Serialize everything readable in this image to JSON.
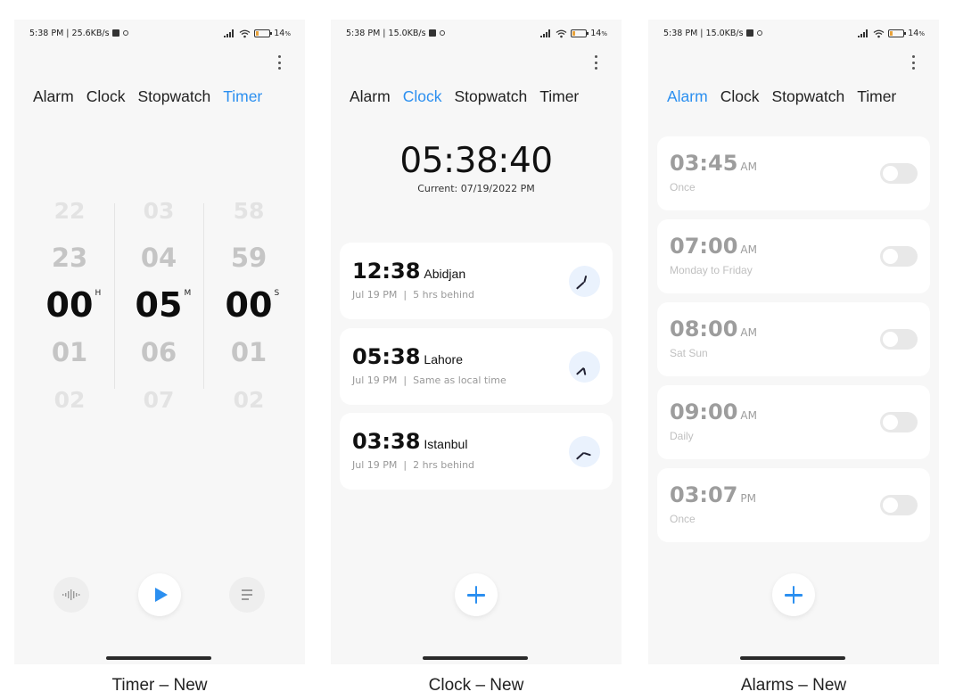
{
  "screens": [
    {
      "status": {
        "time_speed": "5:38 PM | 25.6KB/s",
        "battery_value": "14",
        "battery_unit": "%"
      },
      "tabs": [
        "Alarm",
        "Clock",
        "Stopwatch",
        "Timer"
      ],
      "active_tab": "Timer",
      "timer": {
        "hours": [
          "22",
          "23",
          "00",
          "01",
          "02"
        ],
        "minutes": [
          "03",
          "04",
          "05",
          "06",
          "07"
        ],
        "seconds": [
          "58",
          "59",
          "00",
          "01",
          "02"
        ],
        "units": {
          "hours": "H",
          "minutes": "M",
          "seconds": "S"
        }
      },
      "caption": "Timer – New"
    },
    {
      "status": {
        "time_speed": "5:38 PM | 15.0KB/s",
        "battery_value": "14",
        "battery_unit": "%"
      },
      "tabs": [
        "Alarm",
        "Clock",
        "Stopwatch",
        "Timer"
      ],
      "active_tab": "Clock",
      "clock": {
        "time": "05:38:40",
        "current": "Current: 07/19/2022 PM",
        "cities": [
          {
            "time": "12:38",
            "city": "Abidjan",
            "date": "Jul 19 PM",
            "diff": "5 hrs behind",
            "clock_hands": {
              "hour": 0.5,
              "minute": 38
            }
          },
          {
            "time": "05:38",
            "city": "Lahore",
            "date": "Jul 19 PM",
            "diff": "Same as local time",
            "clock_hands": {
              "hour": 5.6,
              "minute": 38
            }
          },
          {
            "time": "03:38",
            "city": "Istanbul",
            "date": "Jul 19 PM",
            "diff": "2 hrs behind",
            "clock_hands": {
              "hour": 3.6,
              "minute": 38
            }
          }
        ]
      },
      "caption": "Clock – New"
    },
    {
      "status": {
        "time_speed": "5:38 PM | 15.0KB/s",
        "battery_value": "14",
        "battery_unit": "%"
      },
      "tabs": [
        "Alarm",
        "Clock",
        "Stopwatch",
        "Timer"
      ],
      "active_tab": "Alarm",
      "alarms": [
        {
          "time": "03:45",
          "ampm": "AM",
          "repeat": "Once",
          "enabled": false
        },
        {
          "time": "07:00",
          "ampm": "AM",
          "repeat": "Monday to Friday",
          "enabled": false
        },
        {
          "time": "08:00",
          "ampm": "AM",
          "repeat": "Sat Sun",
          "enabled": false
        },
        {
          "time": "09:00",
          "ampm": "AM",
          "repeat": "Daily",
          "enabled": false
        },
        {
          "time": "03:07",
          "ampm": "PM",
          "repeat": "Once",
          "enabled": false
        }
      ],
      "caption": "Alarms – New"
    }
  ],
  "theme": {
    "accent": "#2b8ff0",
    "screen_bg": "#f7f7f7",
    "card_bg": "#ffffff"
  },
  "icons": [
    "more-vert-icon",
    "play-icon",
    "sound-wave-icon",
    "list-icon",
    "add-icon",
    "analog-clock-icon",
    "battery-icon",
    "wifi-icon",
    "signal-icon"
  ]
}
